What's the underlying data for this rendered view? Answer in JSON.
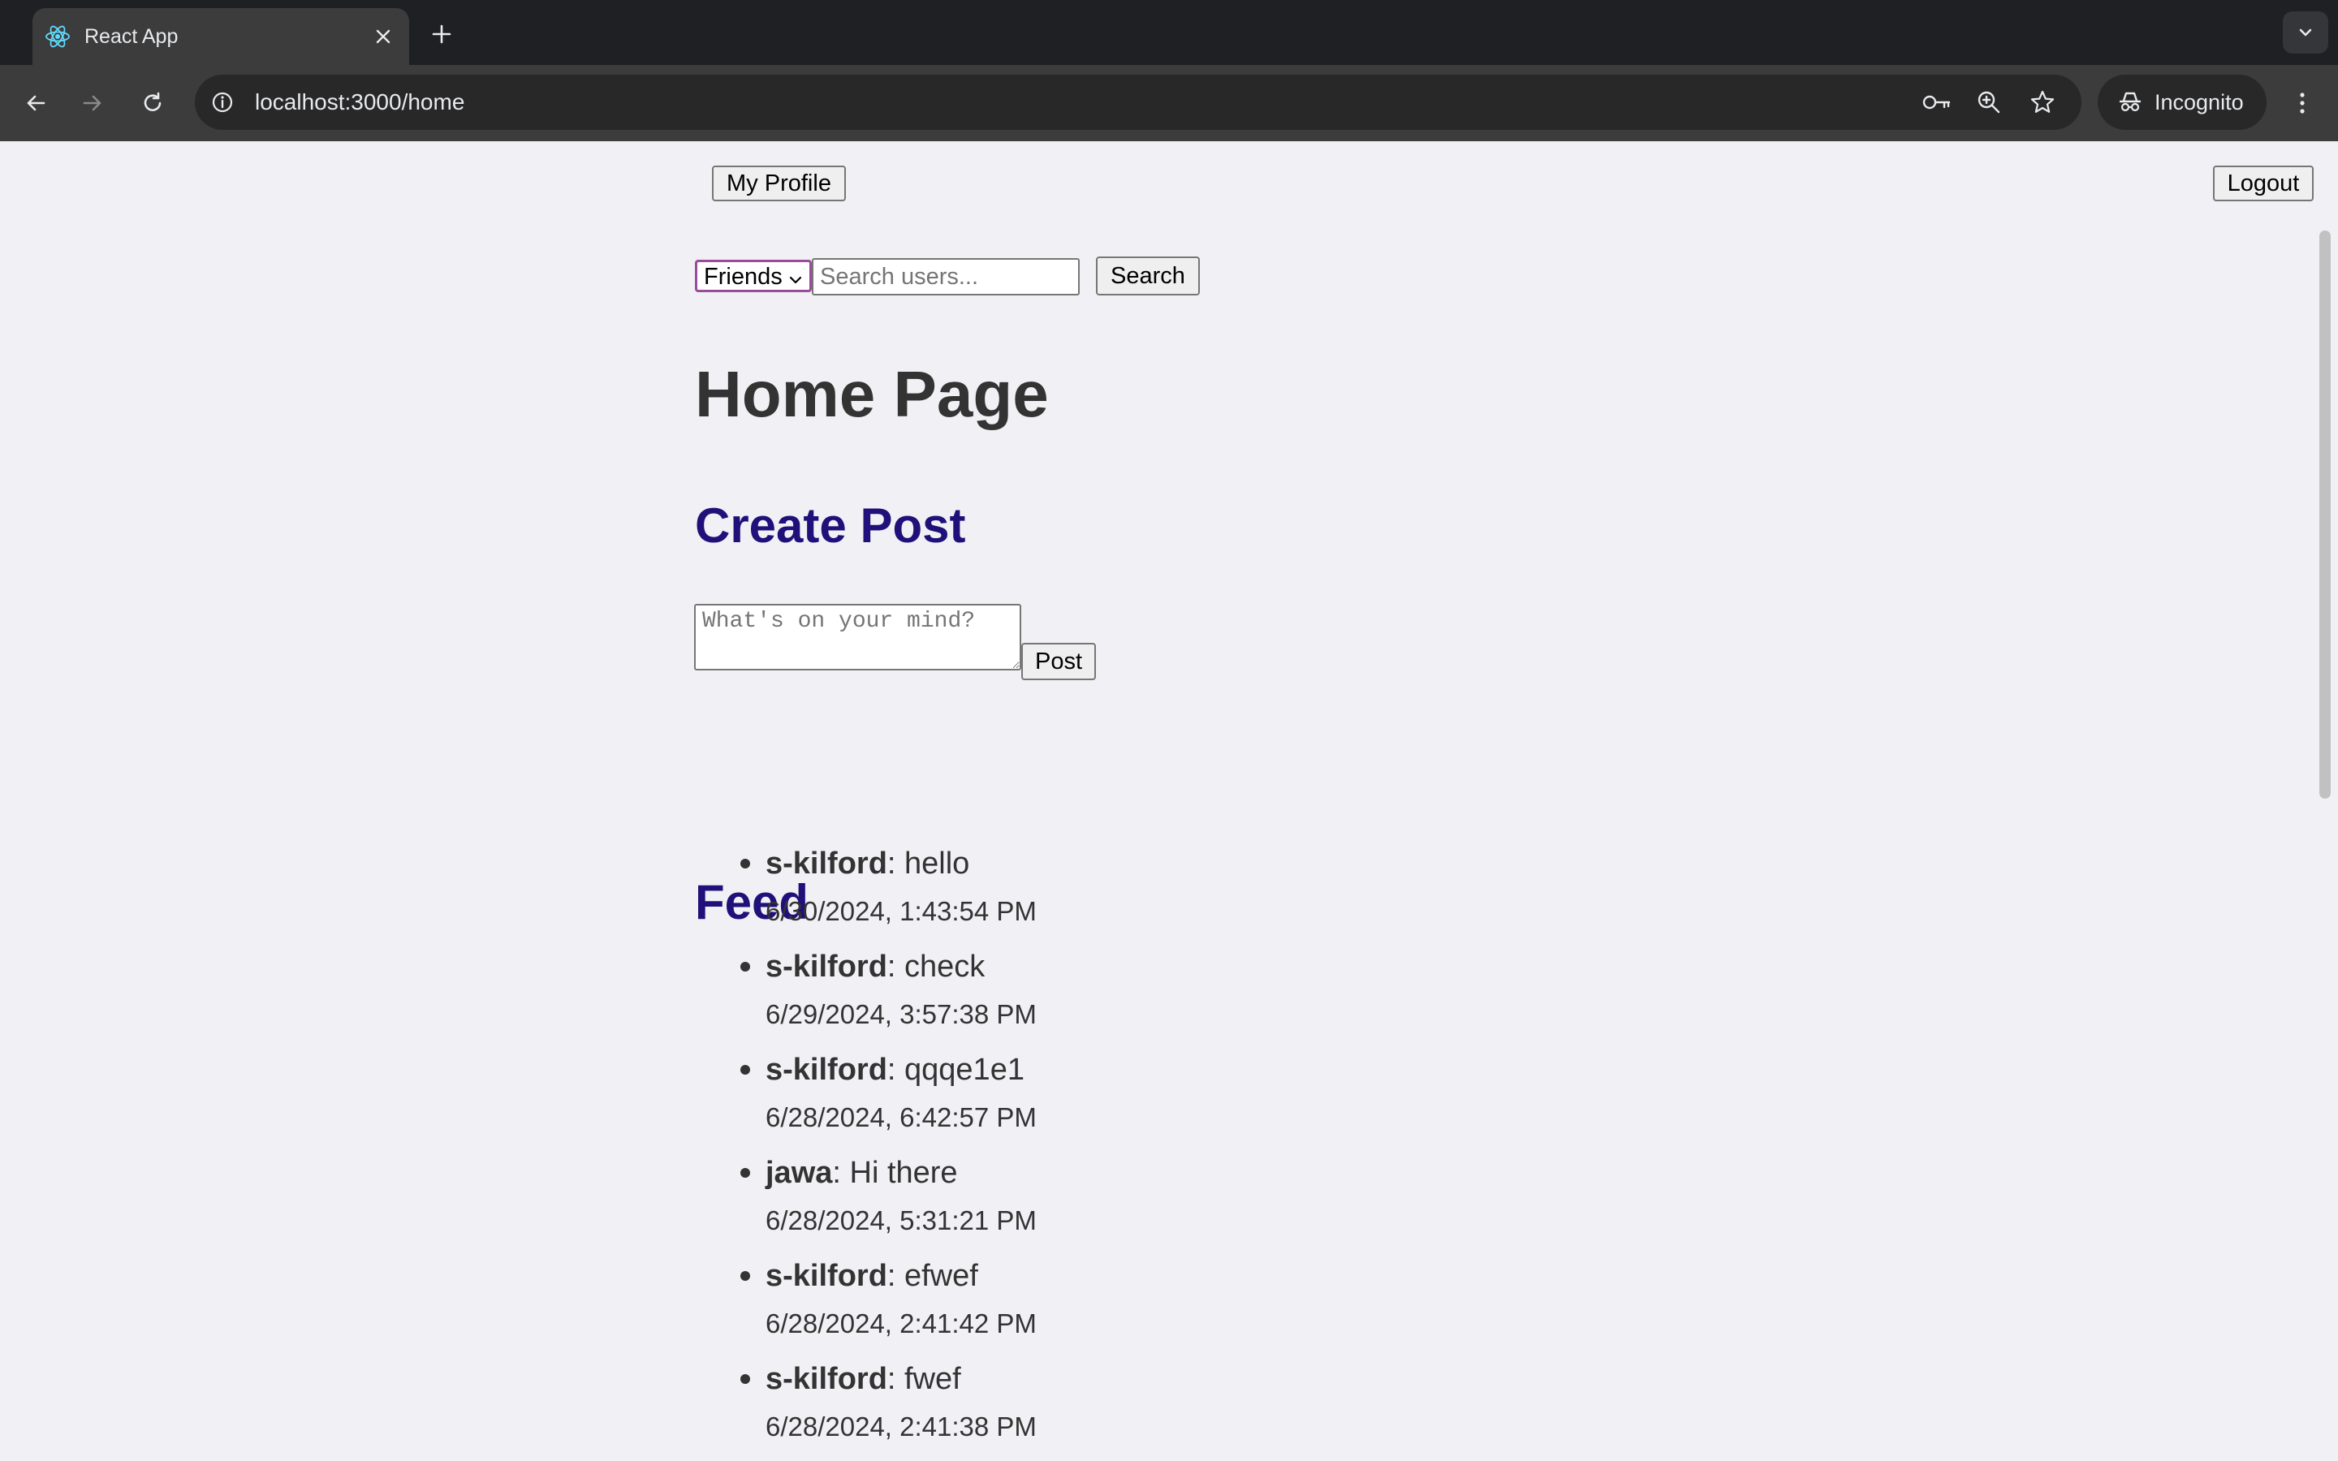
{
  "browser": {
    "tab_title": "React App",
    "url": "localhost:3000/home",
    "mode_label": "Incognito"
  },
  "header": {
    "profile_button": "My Profile",
    "logout_button": "Logout"
  },
  "search": {
    "filter_selected": "Friends",
    "placeholder": "Search users...",
    "button_label": "Search"
  },
  "main": {
    "title": "Home Page",
    "create_post_heading": "Create Post",
    "post_placeholder": "What's on your mind?",
    "post_button": "Post",
    "feed_heading": "Feed"
  },
  "feed": [
    {
      "author": "s-kilford",
      "text": ": hello",
      "time": "6/30/2024, 1:43:54 PM"
    },
    {
      "author": "s-kilford",
      "text": ": check",
      "time": "6/29/2024, 3:57:38 PM"
    },
    {
      "author": "s-kilford",
      "text": ": qqqe1e1",
      "time": "6/28/2024, 6:42:57 PM"
    },
    {
      "author": "jawa",
      "text": ": Hi there",
      "time": "6/28/2024, 5:31:21 PM"
    },
    {
      "author": "s-kilford",
      "text": ": efwef",
      "time": "6/28/2024, 2:41:42 PM"
    },
    {
      "author": "s-kilford",
      "text": ": fwef",
      "time": "6/28/2024, 2:41:38 PM"
    }
  ],
  "colors": {
    "heading_accent": "#20107a",
    "page_background": "#f1f1f5",
    "select_focus": "#9b4b9b"
  }
}
